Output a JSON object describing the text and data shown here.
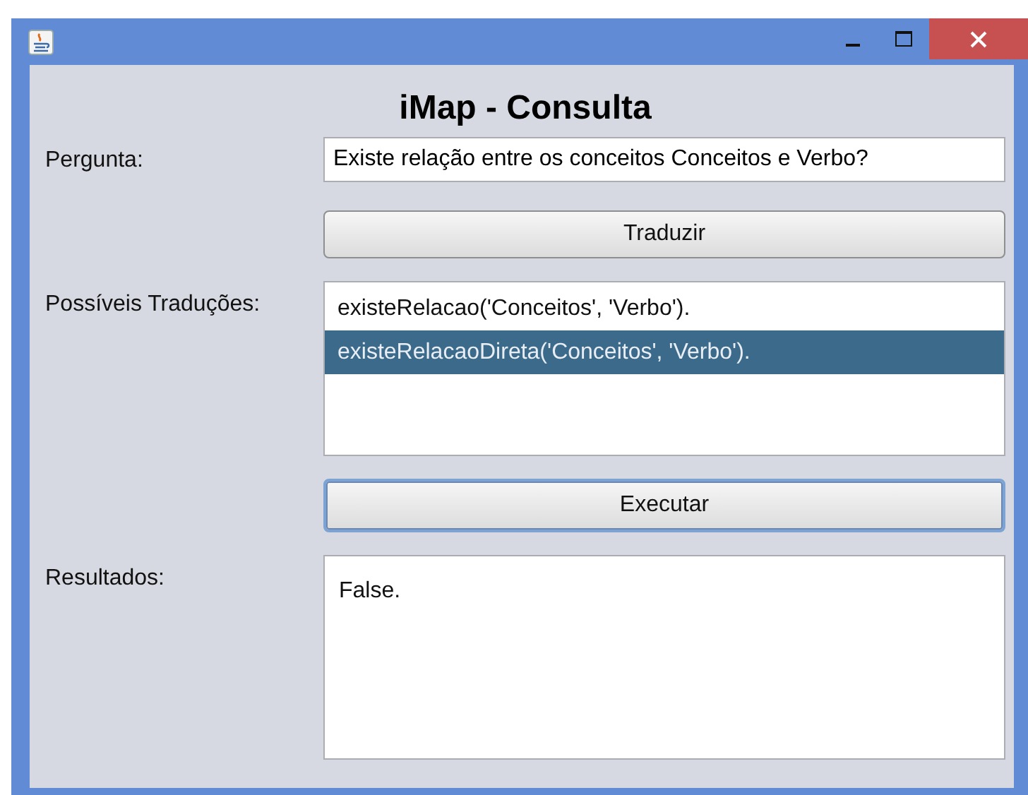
{
  "heading": "iMap - Consulta",
  "question": {
    "label": "Pergunta:",
    "value": "Existe relação entre os conceitos Conceitos e Verbo?"
  },
  "translate_button": {
    "label": "Traduzir",
    "focused": false
  },
  "translations": {
    "label": "Possíveis Traduções:",
    "items": [
      {
        "text": "existeRelacao('Conceitos', 'Verbo').",
        "selected": false
      },
      {
        "text": "existeRelacaoDireta('Conceitos', 'Verbo').",
        "selected": true
      }
    ]
  },
  "execute_button": {
    "label": "Executar",
    "focused": true
  },
  "results": {
    "label": "Resultados:",
    "value": "False."
  }
}
